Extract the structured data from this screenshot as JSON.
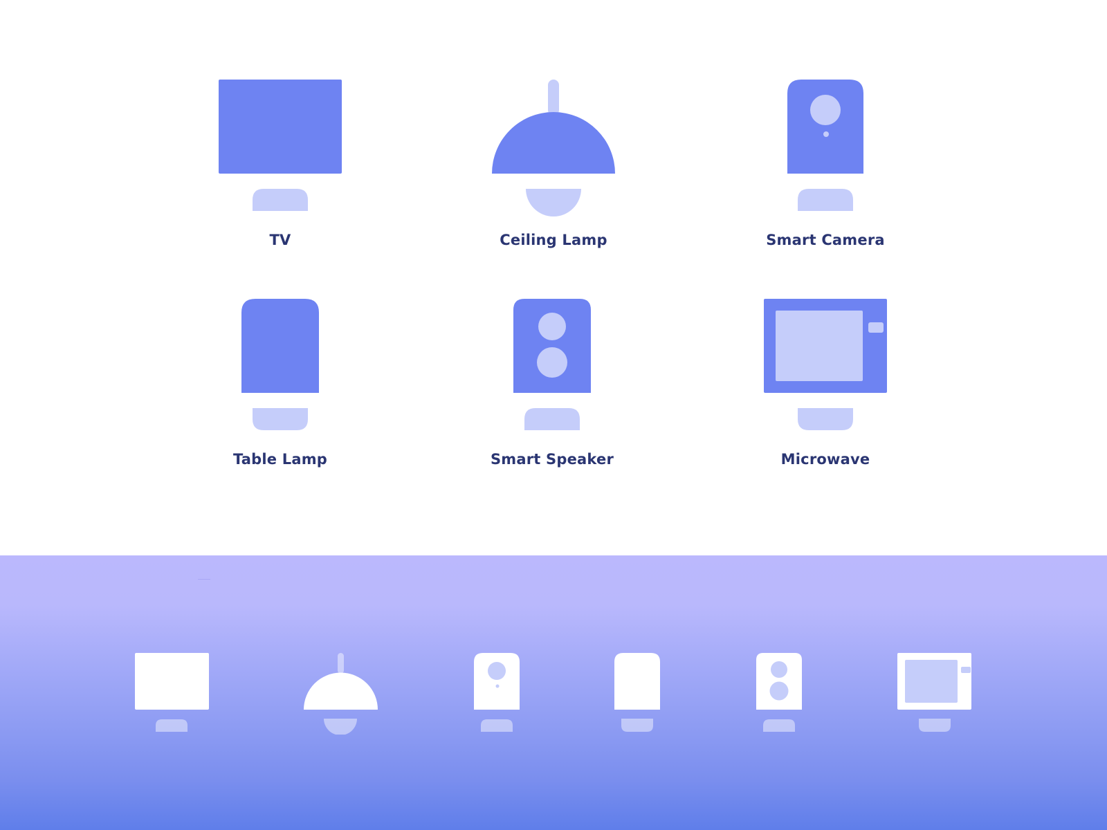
{
  "colors": {
    "primary": "#6e83f2",
    "secondary": "#c5cdfa",
    "label": "#2a3572",
    "white": "#ffffff",
    "background_gradient": [
      "#bbb8fd",
      "#5f7eea"
    ]
  },
  "devices": [
    {
      "id": "tv",
      "label": "TV",
      "icon": "tv-icon"
    },
    {
      "id": "ceiling-lamp",
      "label": "Ceiling Lamp",
      "icon": "ceiling-lamp-icon"
    },
    {
      "id": "smart-camera",
      "label": "Smart Camera",
      "icon": "smart-camera-icon"
    },
    {
      "id": "table-lamp",
      "label": "Table Lamp",
      "icon": "table-lamp-icon"
    },
    {
      "id": "smart-speaker",
      "label": "Smart Speaker",
      "icon": "smart-speaker-icon"
    },
    {
      "id": "microwave",
      "label": "Microwave",
      "icon": "microwave-icon"
    }
  ]
}
